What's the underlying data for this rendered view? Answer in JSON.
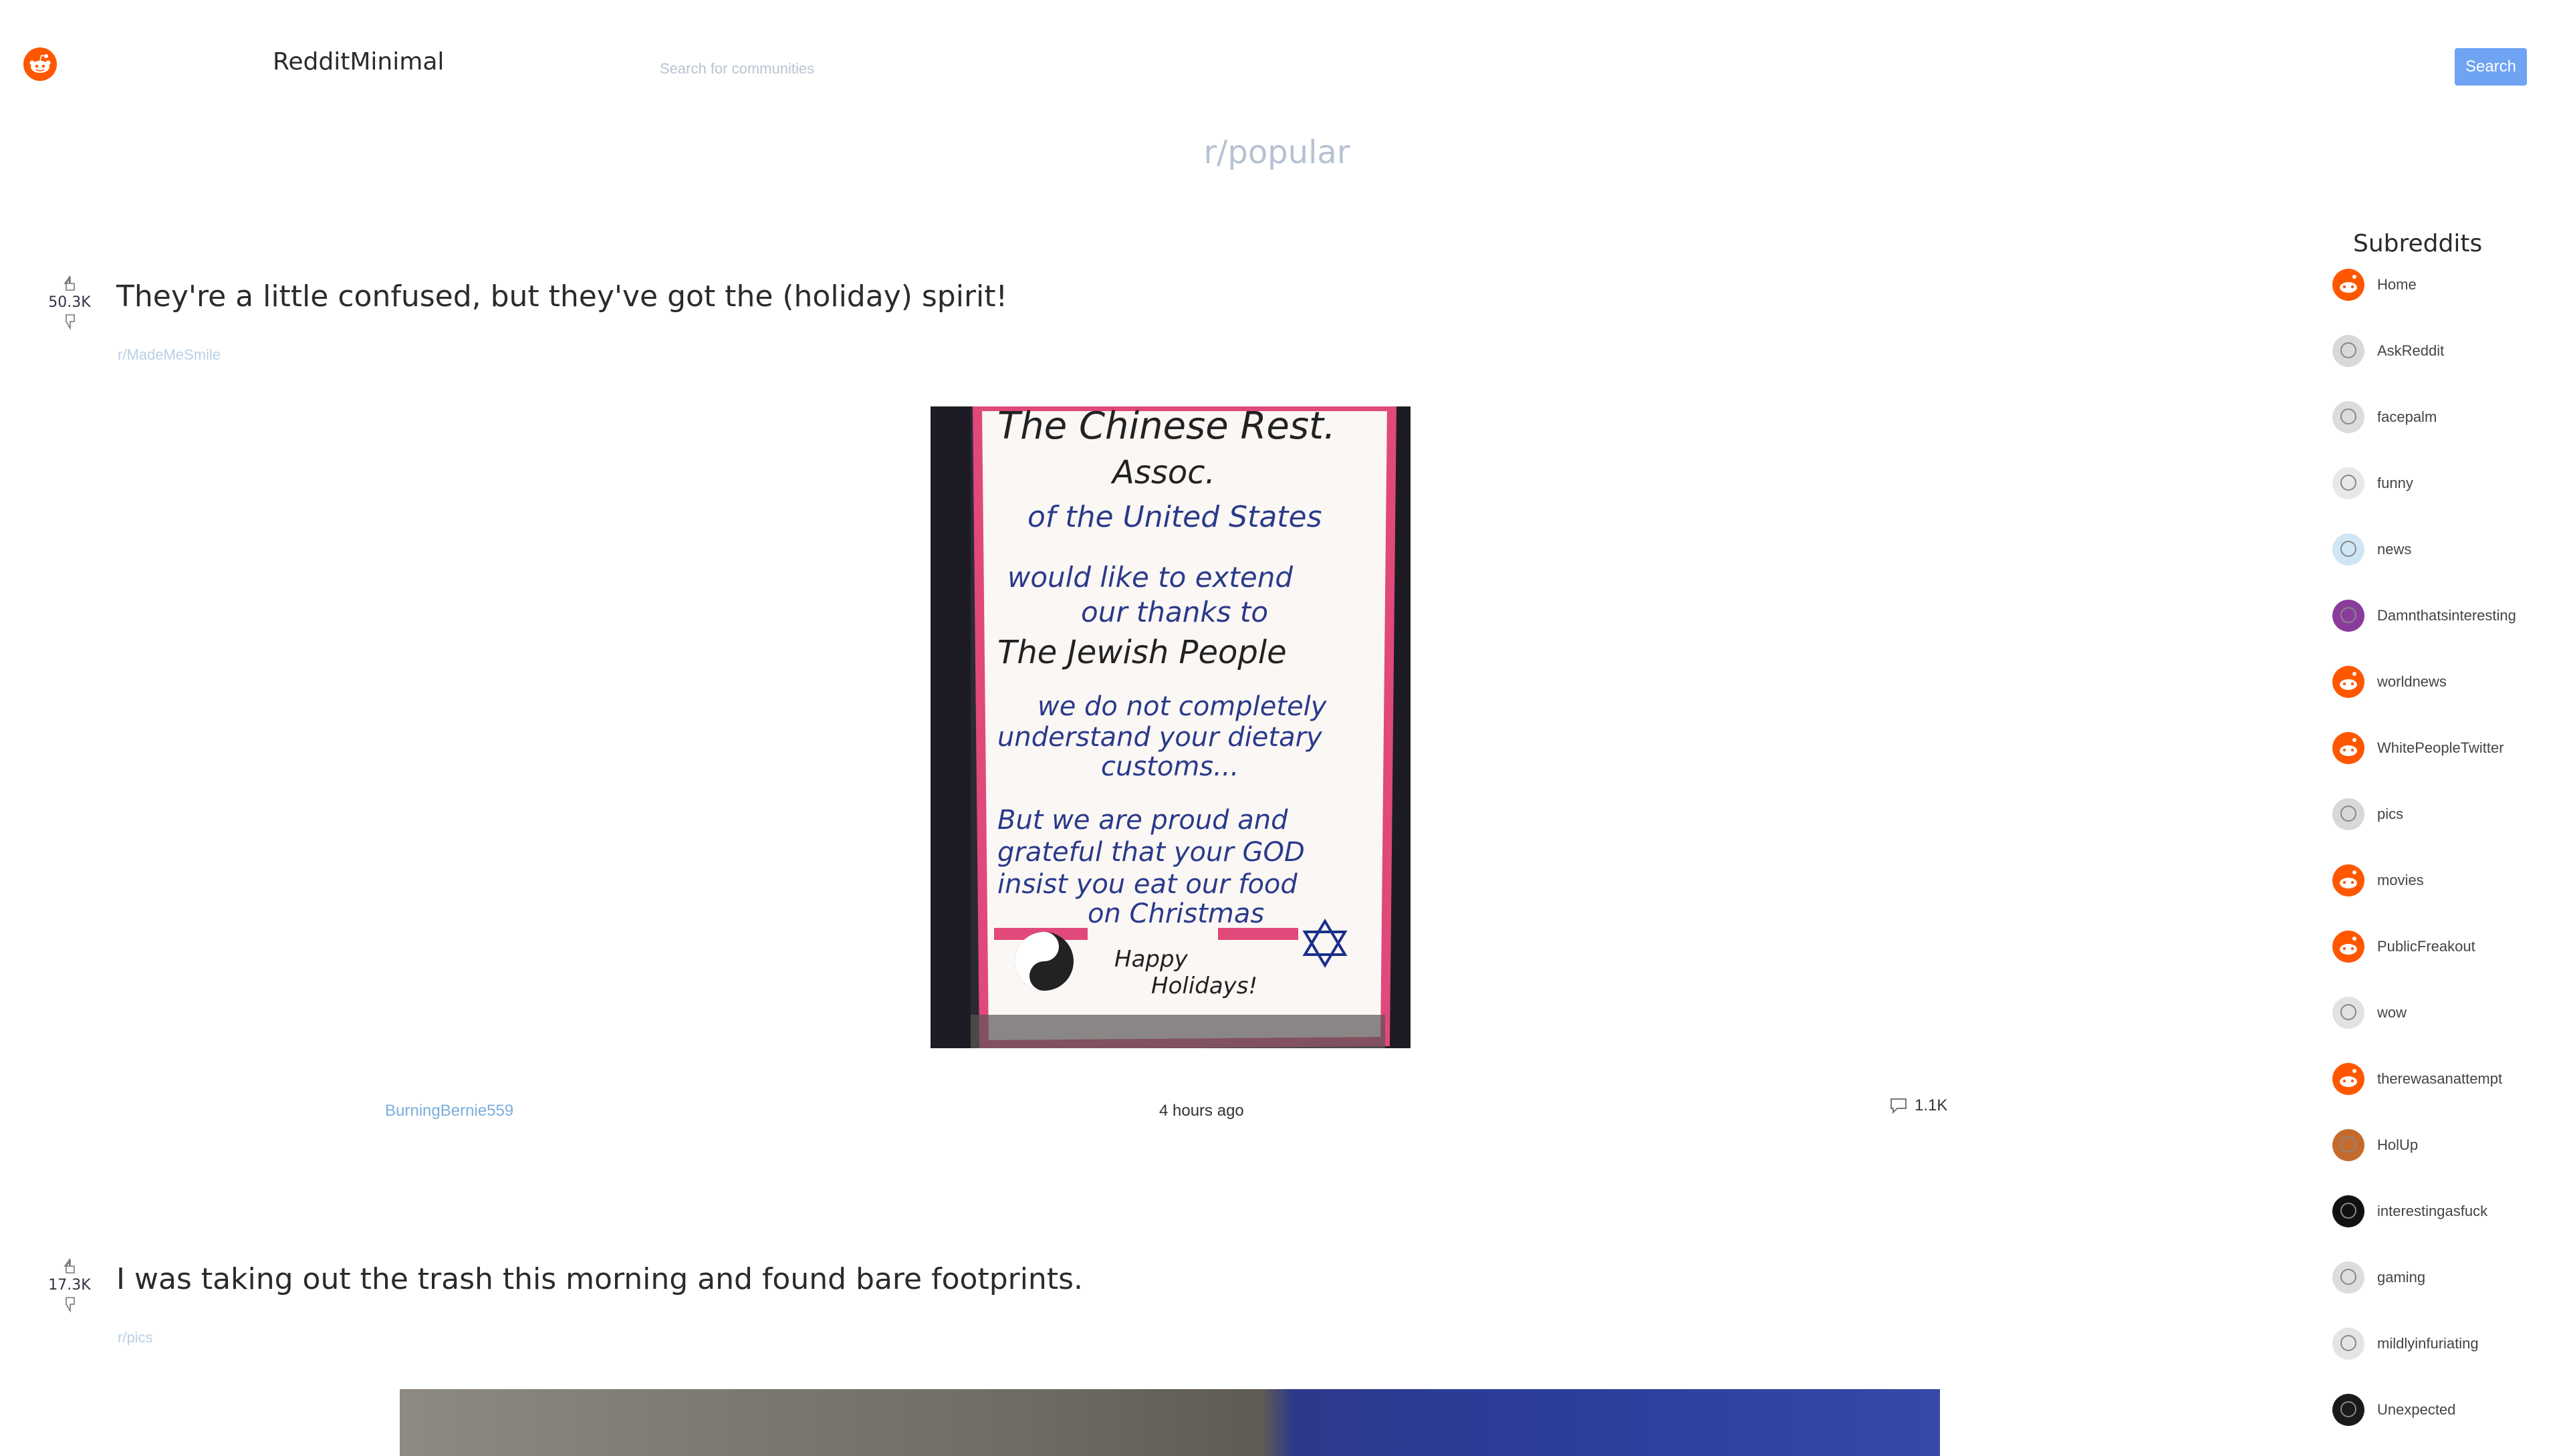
{
  "header": {
    "brand": "RedditMinimal",
    "search_placeholder": "Search for communities",
    "search_button": "Search"
  },
  "page_title": "r/popular",
  "posts": [
    {
      "score": "50.3K",
      "title": "They're a little confused, but they've got the (holiday) spirit!",
      "subreddit": "r/MadeMeSmile",
      "author": "BurningBernie559",
      "time": "4 hours ago",
      "comments": "1.1K",
      "image_text": [
        "The Chinese Rest.",
        "Assoc.",
        "of the United States",
        "would like to extend",
        "our thanks to",
        "The Jewish People",
        "we do not completely",
        "understand your dietary",
        "customs...",
        "But we are proud and",
        "grateful that your GOD",
        "insist you eat our food",
        "on Christmas",
        "Happy",
        "Holidays!"
      ]
    },
    {
      "score": "17.3K",
      "title": "I was taking out the trash this morning and found bare footprints.",
      "subreddit": "r/pics"
    }
  ],
  "sidebar": {
    "title": "Subreddits",
    "items": [
      {
        "label": "Home",
        "icon": "reddit-icon"
      },
      {
        "label": "AskReddit",
        "icon": "askreddit-icon"
      },
      {
        "label": "facepalm",
        "icon": "facepalm-icon"
      },
      {
        "label": "funny",
        "icon": "funny-icon"
      },
      {
        "label": "news",
        "icon": "news-icon"
      },
      {
        "label": "Damnthatsinteresting",
        "icon": "damnthatsinteresting-icon"
      },
      {
        "label": "worldnews",
        "icon": "reddit-icon"
      },
      {
        "label": "WhitePeopleTwitter",
        "icon": "reddit-icon"
      },
      {
        "label": "pics",
        "icon": "pics-icon"
      },
      {
        "label": "movies",
        "icon": "reddit-icon"
      },
      {
        "label": "PublicFreakout",
        "icon": "reddit-icon"
      },
      {
        "label": "wow",
        "icon": "wow-icon"
      },
      {
        "label": "therewasanattempt",
        "icon": "reddit-icon"
      },
      {
        "label": "HolUp",
        "icon": "holup-icon"
      },
      {
        "label": "interestingasfuck",
        "icon": "interestingasfuck-icon"
      },
      {
        "label": "gaming",
        "icon": "gaming-icon"
      },
      {
        "label": "mildlyinfuriating",
        "icon": "mildlyinfuriating-icon"
      },
      {
        "label": "Unexpected",
        "icon": "unexpected-icon"
      }
    ]
  },
  "colors": {
    "reddit_orange": "#ff5700",
    "button_blue": "#6fa3f3",
    "sign_pink": "#e0497a"
  }
}
